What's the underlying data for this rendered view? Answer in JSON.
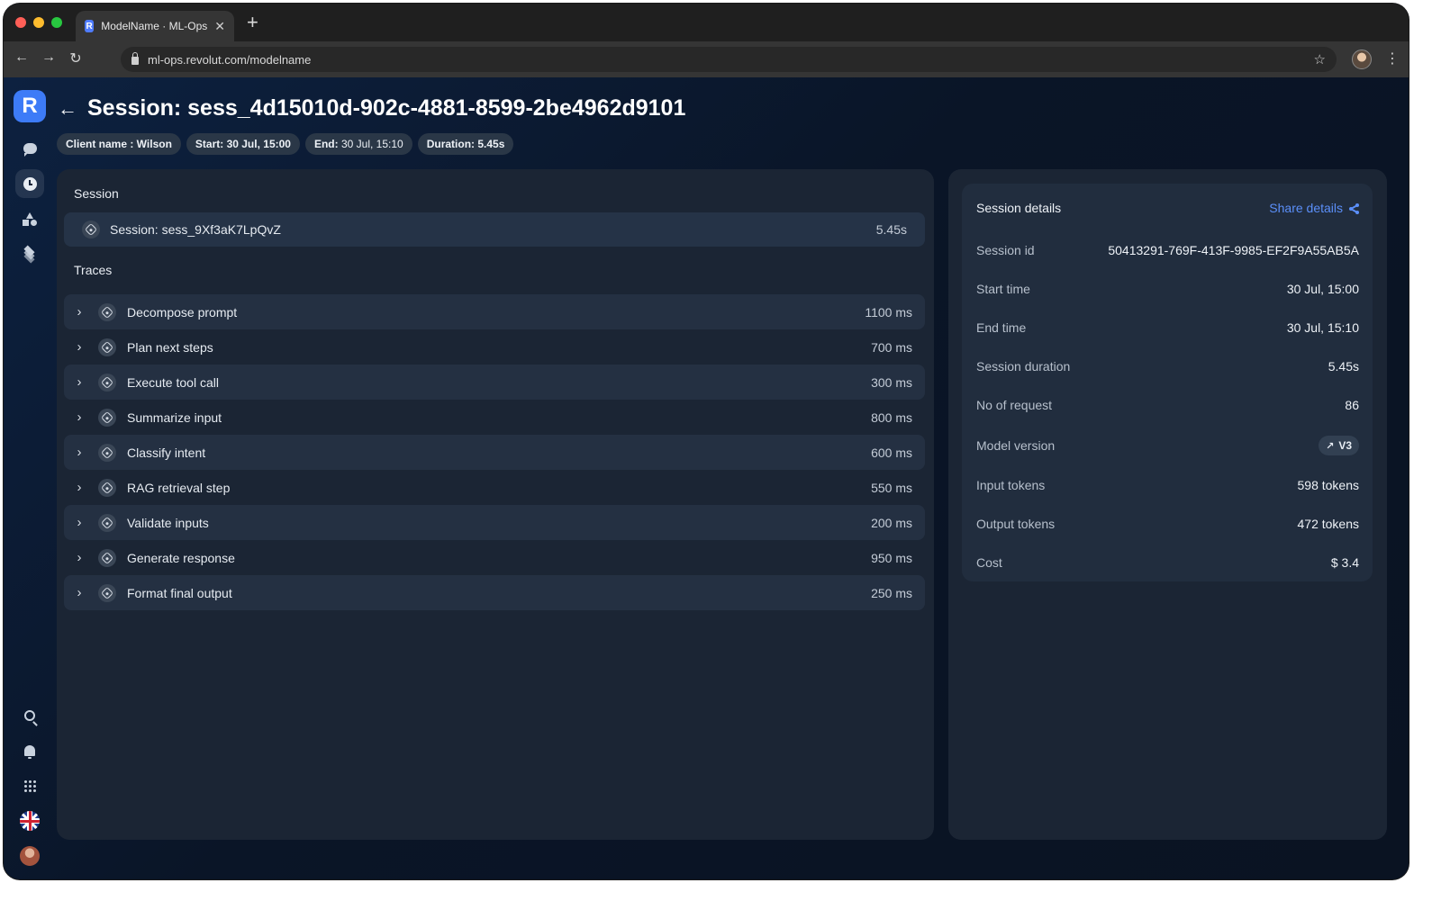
{
  "browser": {
    "tab_title": "ModelName · ML-Ops",
    "tab_favicon": "R",
    "url": "ml-ops.revolut.com/modelname"
  },
  "sidebar": {
    "logo": "R",
    "items": [
      {
        "icon": "chat-icon",
        "active": false
      },
      {
        "icon": "clock-icon",
        "active": true
      },
      {
        "icon": "shapes-icon",
        "active": false
      },
      {
        "icon": "layers-icon",
        "active": false
      }
    ],
    "bottom_items": [
      "search-icon",
      "bell-icon",
      "apps-grid-icon",
      "uk-flag-icon",
      "user-avatar"
    ]
  },
  "header": {
    "title": "Session: sess_4d15010d-902c-4881-8599-2be4962d9101",
    "chips": {
      "client": "Client name : Wilson",
      "start": "Start: 30 Jul, 15:00",
      "end_label": "End:",
      "end_value": " 30 Jul, 15:10",
      "duration": "Duration: 5.45s"
    }
  },
  "session_section": {
    "title": "Session",
    "label": "Session: sess_9Xf3aK7LpQvZ",
    "duration": "5.45s"
  },
  "traces": {
    "title": "Traces",
    "items": [
      {
        "label": "Decompose prompt",
        "duration": "1100 ms"
      },
      {
        "label": "Plan next steps",
        "duration": "700 ms"
      },
      {
        "label": "Execute tool call",
        "duration": "300 ms"
      },
      {
        "label": "Summarize input",
        "duration": "800 ms"
      },
      {
        "label": "Classify intent",
        "duration": "600 ms"
      },
      {
        "label": "RAG retrieval step",
        "duration": "550 ms"
      },
      {
        "label": "Validate inputs",
        "duration": "200 ms"
      },
      {
        "label": "Generate response",
        "duration": "950 ms"
      },
      {
        "label": "Format final output",
        "duration": "250 ms"
      }
    ]
  },
  "details": {
    "title": "Session details",
    "share_label": "Share details",
    "rows": [
      {
        "label": "Session id",
        "value": "50413291-769F-413F-9985-EF2F9A55AB5A"
      },
      {
        "label": "Start time",
        "value": "30 Jul, 15:00"
      },
      {
        "label": "End time",
        "value": "30 Jul, 15:10"
      },
      {
        "label": "Session duration",
        "value": "5.45s"
      },
      {
        "label": "No of request",
        "value": "86"
      },
      {
        "label": "Model version",
        "value": "V3"
      },
      {
        "label": "Input tokens",
        "value": "598 tokens"
      },
      {
        "label": "Output tokens",
        "value": "472 tokens"
      },
      {
        "label": "Cost",
        "value": "$ 3.4"
      }
    ]
  },
  "colors": {
    "accent": "#5b8ff9",
    "logo": "#3d7bf7",
    "panel": "#1b2534",
    "background": "#0b1526"
  }
}
